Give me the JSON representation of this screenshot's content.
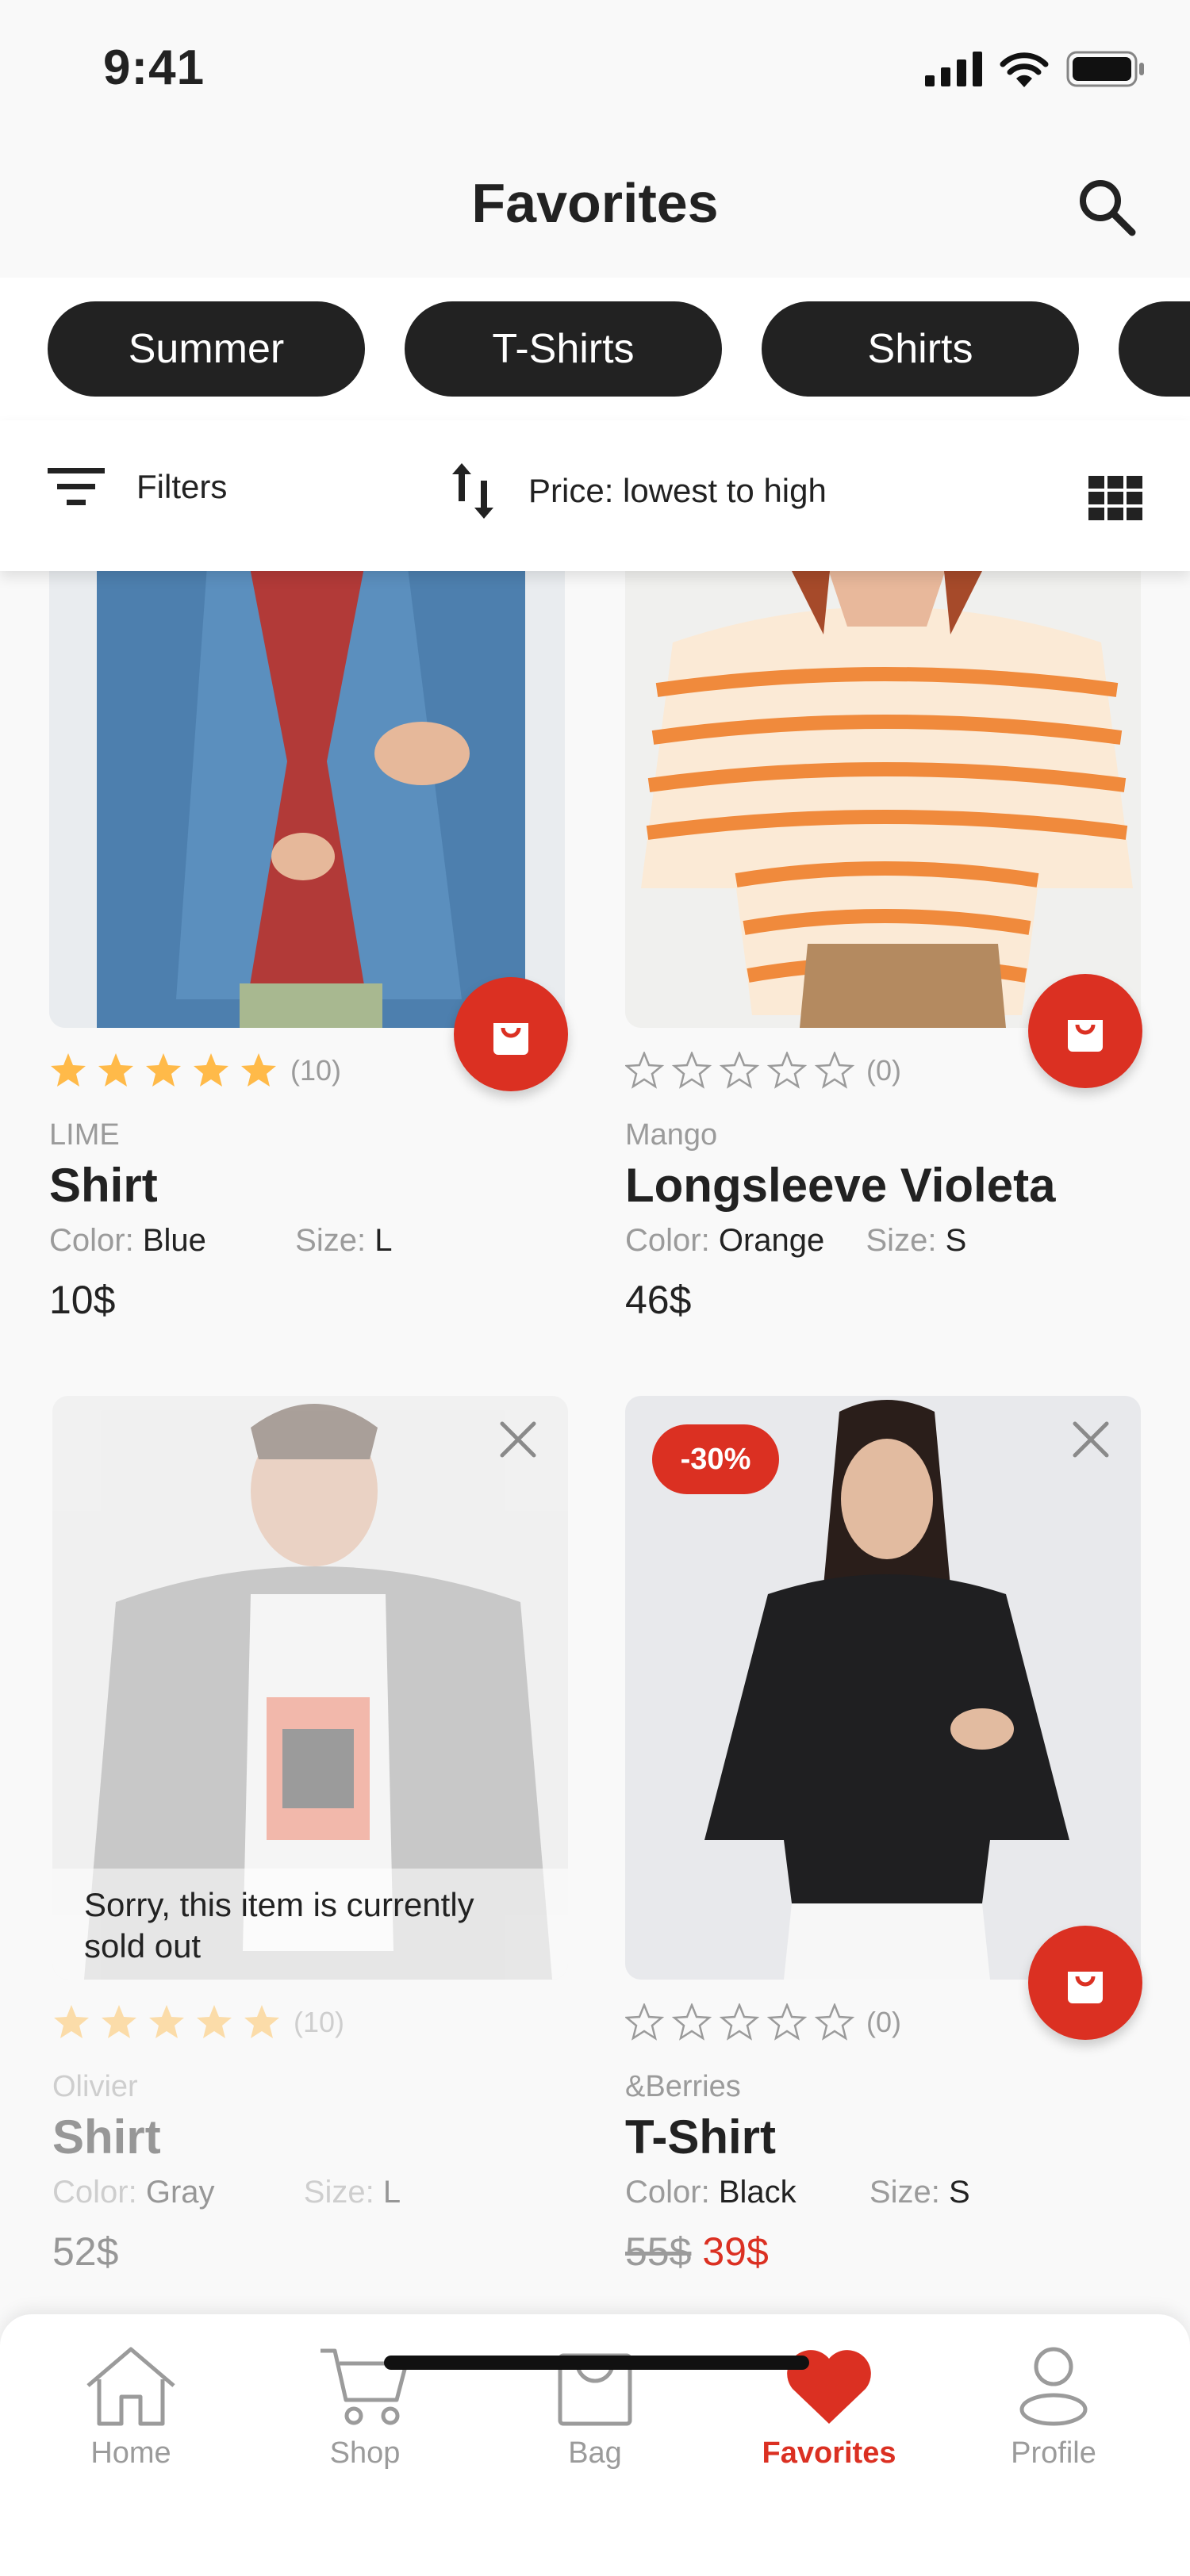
{
  "status_bar": {
    "time": "9:41"
  },
  "header": {
    "title": "Favorites"
  },
  "chips": [
    "Summer",
    "T-Shirts",
    "Shirts"
  ],
  "toolbar": {
    "filters_label": "Filters",
    "sort_label": "Price: lowest to high"
  },
  "products": [
    {
      "brand": "LIME",
      "name": "Shirt",
      "color_label": "Color:",
      "color": "Blue",
      "size_label": "Size:",
      "size": "L",
      "price": "10$",
      "rating": 5,
      "reviews": "(10)",
      "sold_out": false
    },
    {
      "brand": "Mango",
      "name": "Longsleeve Violeta",
      "color_label": "Color:",
      "color": "Orange",
      "size_label": "Size:",
      "size": "S",
      "price": "46$",
      "rating": 0,
      "reviews": "(0)",
      "sold_out": false
    },
    {
      "brand": "Olivier",
      "name": "Shirt",
      "color_label": "Color:",
      "color": "Gray",
      "size_label": "Size:",
      "size": "L",
      "price": "52$",
      "rating": 5,
      "reviews": "(10)",
      "sold_out": true,
      "sold_out_note": "Sorry, this item is currently sold out"
    },
    {
      "brand": "&Berries",
      "name": "T-Shirt",
      "color_label": "Color:",
      "color": "Black",
      "size_label": "Size:",
      "size": "S",
      "old_price": "55$",
      "price": "39$",
      "discount": "-30%",
      "rating": 0,
      "reviews": "(0)",
      "sold_out": false
    }
  ],
  "nav": [
    {
      "label": "Home",
      "icon": "home-icon"
    },
    {
      "label": "Shop",
      "icon": "cart-icon"
    },
    {
      "label": "Bag",
      "icon": "bag-icon"
    },
    {
      "label": "Favorites",
      "icon": "heart-icon",
      "active": true
    },
    {
      "label": "Profile",
      "icon": "profile-icon"
    }
  ],
  "colors": {
    "accent": "#DB3022",
    "star": "#FFBA49",
    "text": "#222222",
    "muted": "#9B9B9B"
  }
}
